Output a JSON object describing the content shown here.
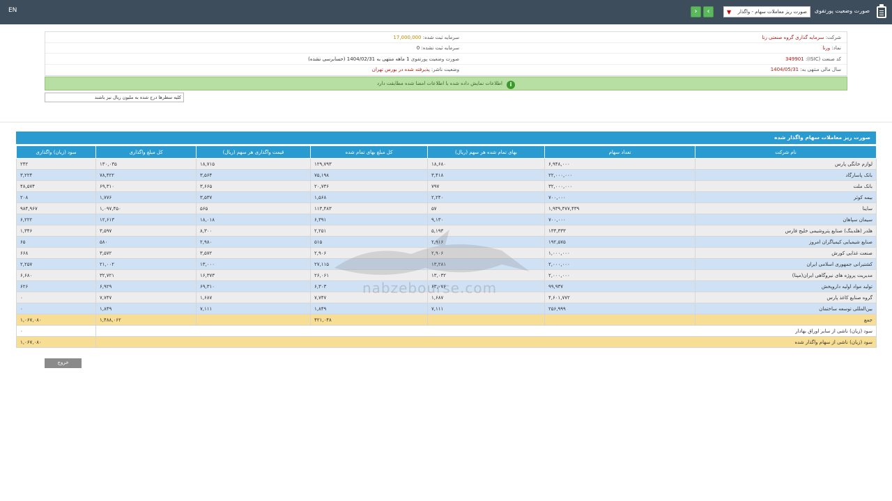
{
  "topbar": {
    "lang": "EN",
    "title": "صورت وضعیت پورتفوی",
    "select_value": "صورت ریز معاملات سهام - واگذار",
    "next_label": "‹",
    "prev_label": "›",
    "colors": {
      "bg": "#3e4d5c",
      "nav": "#5cb85c"
    }
  },
  "info": {
    "company_label": "شرکت:",
    "company_value": "سرمایه گذاری گروه صنعتی رنا",
    "capital_label": "سرمایه ثبت شده:",
    "capital_value": "17,000,000",
    "symbol_label": "نماد:",
    "symbol_value": "ورنا",
    "unregistered_label": "سرمایه ثبت نشده:",
    "unregistered_value": "0",
    "isic_label": "کد صنعت (ISIC):",
    "isic_value": "349901",
    "period_label": "صورت وضعیت پورتفوی",
    "period_value": "1 ماهه منتهی به 1404/02/31 (حسابرسی نشده)",
    "year_label": "سال مالی منتهی به:",
    "year_value": "1404/05/31",
    "status_label": "وضعیت ناشر:",
    "status_value": "پذیرفته شده در بورس تهران"
  },
  "alert": {
    "text": "اطلاعات نمایش داده شده با اطلاعات امضا شده مطابقت دارد",
    "icon": "info-icon"
  },
  "search": {
    "text": "کلیه سطرها درج شده به ملیون ریال نیز باشند"
  },
  "table": {
    "title": "صورت ریز معاملات سهام واگذار شده",
    "columns": [
      "نام شرکت",
      "تعداد سهام",
      "بهای تمام شده هر سهم (ریال)",
      "کل مبلغ بهای تمام شده",
      "قیمت واگذاری هر سهم (ریال)",
      "کل مبلغ واگذاری",
      "سود (زیان) واگذاری"
    ],
    "rows": [
      [
        "لوازم خانگی پارس",
        "۶,۹۴۸,۰۰۰",
        "۱۸,۶۸۰",
        "۱۲۹,۷۹۳",
        "۱۸,۷۱۵",
        "۱۳۰,۰۳۵",
        "۲۴۲"
      ],
      [
        "بانک پاسارگاد",
        "۲۲,۰۰۰,۰۰۰",
        "۳,۴۱۸",
        "۷۵,۱۹۸",
        "۳,۵۶۴",
        "۷۸,۴۲۲",
        "۳,۲۲۴"
      ],
      [
        "بانک ملت",
        "۳۲,۰۰۰,۰۰۰",
        "۷۹۷",
        "۲۰,۷۳۶",
        "۳,۶۶۵",
        "۶۹,۳۱۰",
        "۴۸,۵۷۴"
      ],
      [
        "بیمه کوثر",
        "۷۰۰,۰۰۰",
        "۲,۲۴۰",
        "۱,۵۶۸",
        "۳,۵۳۷",
        "۱,۷۷۶",
        "۲۰۸"
      ],
      [
        "ساینا",
        "۱,۹۳۹,۴۷۷,۴۳۹",
        "۵۷",
        "۱۱۳,۴۸۳",
        "۵۶۵",
        "۱,۰۹۷,۴۵۰",
        "۹۸۴,۹۶۷"
      ],
      [
        "سیمان سپاهان",
        "۷۰۰,۰۰۰",
        "۹,۱۳۰",
        "۶,۳۹۱",
        "۱۸,۰۱۸",
        "۱۲,۶۱۳",
        "۶,۲۲۲"
      ],
      [
        "هلدر (هلدینگ) صنایع پتروشیمی خلیج فارس",
        "۱۳۳,۳۳۳",
        "۵,۱۹۳",
        "۲,۲۵۱",
        "۸,۳۰۰",
        "۳,۵۹۷",
        "۱,۳۴۶"
      ],
      [
        "صنایع شیمیایی کیمیاگران امروز",
        "۱۹۲,۵۷۵",
        "۲,۹۱۶",
        "۵۱۵",
        "۲,۹۸۰",
        "۵۸۰",
        "۶۵"
      ],
      [
        "صنعت غذایی کورش",
        "۱,۰۰۰,۰۰۰",
        "۲,۹۰۶",
        "۲,۹۰۶",
        "۳,۵۷۲",
        "۳,۵۷۲",
        "۶۶۸"
      ],
      [
        "کشتیرانی جمهوری اسلامی ایران",
        "۲,۰۰۰,۰۰۰",
        "۱۳,۲۸۱",
        "۲۷,۱۱۵",
        "۱۳,۰۰۰",
        "۲۱,۰۰۲",
        "۲,۲۵۷"
      ],
      [
        "مدیریت پروژه های نیروگاهی ایران(مپنا)",
        "۲,۰۰۰,۰۰۰",
        "۱۳,۰۳۲",
        "۲۶,۰۶۱",
        "۱۶,۳۷۳",
        "۳۲,۷۲۱",
        "۶,۶۸۰"
      ],
      [
        "تولید مواد اولیه داروپخش",
        "۹۹,۹۳۷",
        "۶۳,۰۷۶",
        "۶,۳۰۳",
        "۶۹,۳۱۰",
        "۶,۹۲۹",
        "۶۲۶"
      ],
      [
        "گروه صنایع کاغذ پارس",
        "۴,۶۰۱,۷۷۲",
        "۱,۶۸۷",
        "۷,۷۴۷",
        "۱,۶۸۷",
        "۷,۷۴۷",
        "۰"
      ],
      [
        "بین‌المللی توسعه ساختمان",
        "۲۵۶,۹۹۹",
        "۷,۱۱۱",
        "۱,۸۴۹",
        "۷,۱۱۱",
        "۱,۸۴۹",
        "۰"
      ]
    ],
    "total_label": "جمع",
    "total_cost": "۴۲۱,۰۴۸",
    "total_sale": "۱,۴۸۸,۰۶۲",
    "total_profit": "۱,۰۶۷,۰۸۰",
    "line_other_label": "سود (زیان) ناشی از سایر اوراق بهادار",
    "line_other_value": "۰",
    "line_net_label": "سود (زیان) ناشی از سهام واگذار شده",
    "line_net_value": "۱,۰۶۷,۰۸۰",
    "colors": {
      "header": "#2a9bd1",
      "odd": "#ededed",
      "even": "#cfe1f5",
      "total": "#f8dd94"
    }
  },
  "exit_button": "خروج",
  "watermark": {
    "url": "nabzebourse.com"
  }
}
